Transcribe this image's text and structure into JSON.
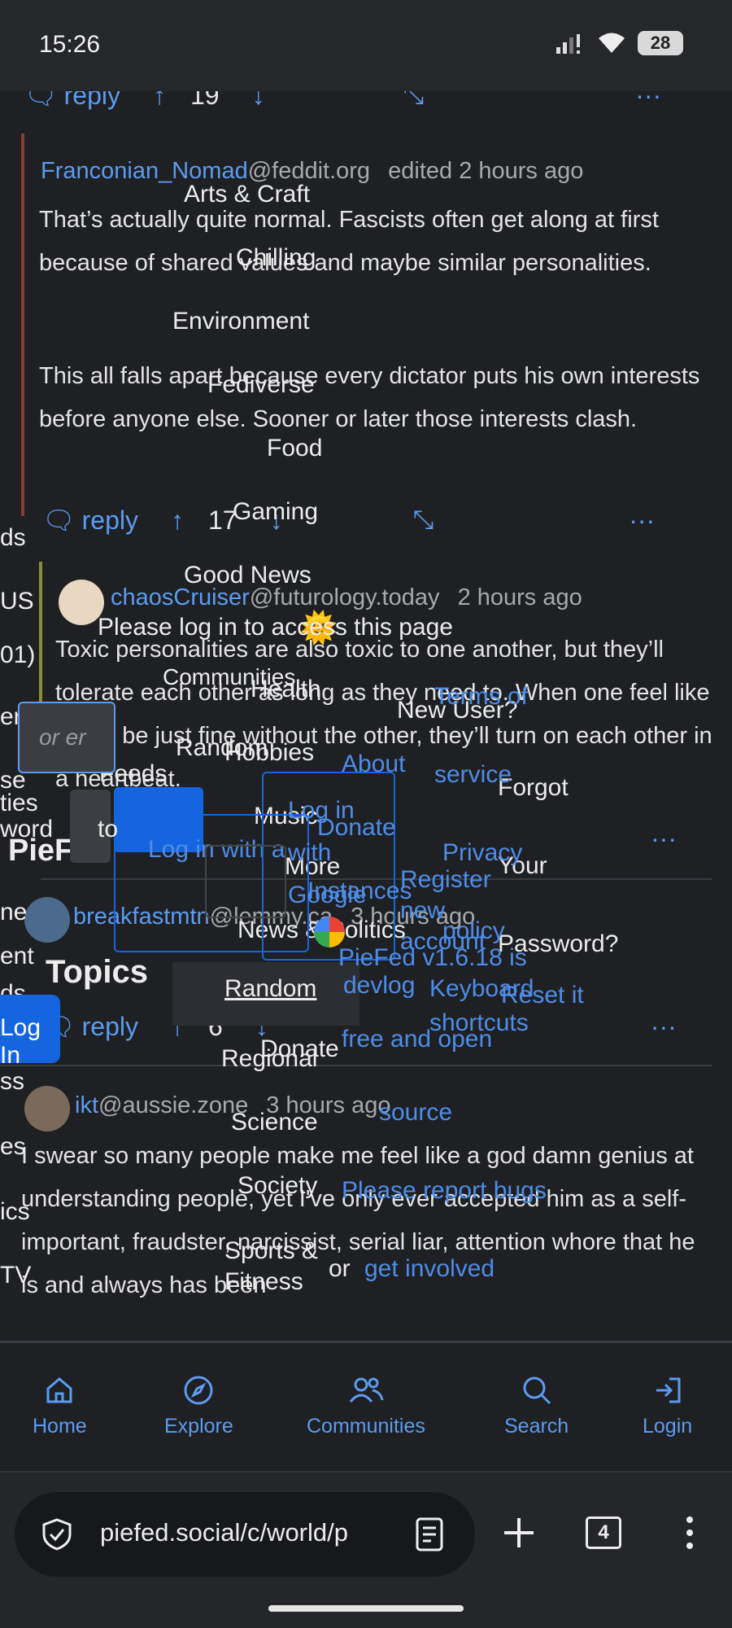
{
  "status_bar": {
    "time": "15:26",
    "battery": "28"
  },
  "thread": {
    "top_actions": {
      "reply": "reply",
      "score": "19"
    },
    "comment1": {
      "author": "Franconian_Nomad",
      "instance": "@feddit.org",
      "meta": "edited 2 hours ago",
      "para1": "That’s actually quite normal. Fascists often get along at first because of shared values and maybe similar personalities.",
      "para2": "This all falls apart because every dictator puts his own interests before anyone else. Sooner or later those interests clash.",
      "reply": "reply",
      "score": "17"
    },
    "comment2": {
      "author": "chaosCruiser",
      "instance": "@futurology.today",
      "meta": "2 hours ago",
      "text": "Toxic personalities are also toxic to one another, but they’ll tolerate each other as long as they need to. When one feel like they’ll be just fine without the other, they’ll turn on each other in a heartbeat."
    },
    "comment3": {
      "author": "breakfastmtn",
      "instance": "@lemmy.ca",
      "meta": "3 hours ago",
      "reply": "reply",
      "score": "6"
    },
    "comment4": {
      "author": "ikt",
      "instance": "@aussie.zone",
      "meta": "3 hours ago",
      "text": "I swear so many people make me feel like a god damn genius at understanding people, yet I've only ever accepted him as a self-important, fraudster, narcissist, serial liar, attention whore that he is and always has been"
    }
  },
  "overlay_menu": {
    "topics": [
      "Arts & Craft",
      "Chilling",
      "Environment",
      "Fediverse",
      "Food",
      "Gaming",
      "Good News",
      "Health",
      "Hobbies",
      "Music",
      "News & Politics",
      "Regional",
      "Science",
      "Society",
      "Sports & Fitness"
    ],
    "communities_label": "Communities",
    "random_label": "Random",
    "more_label": "More",
    "donate_label": "Donate",
    "topics_heading": "Topics",
    "random_button": "Random",
    "login_prompt": "Please log in to access this page",
    "login_button": "Log In",
    "login_google": "Log in with Google",
    "login_with_a": "Log in with a",
    "new_user": "New User?",
    "register": "Register new account",
    "forgot_password": "Forgot Your Password?",
    "reset_it": "Reset it",
    "footer_about": "About",
    "footer_donate": "Donate",
    "footer_terms": "Terms of service",
    "footer_privacy": "Privacy policy",
    "footer_instances": "Instances",
    "footer_version": "PieFed v1.6.18 is",
    "footer_devlog": "devlog",
    "footer_keyboard": "Keyboard shortcuts",
    "footer_free": "free and open",
    "footer_source": "source",
    "footer_report": "Please report bugs",
    "footer_or": "or",
    "footer_involved": "get involved",
    "left_fragments": [
      "ds",
      "US",
      "01)",
      "en",
      "se",
      "ties",
      "word",
      "ne",
      "ent",
      "ds",
      "ss",
      "es",
      "ics",
      "TV"
    ],
    "piefed_fragment": "PieF",
    "feeds": "Feeds",
    "to_label": "to",
    "input_placeholder": "or er"
  },
  "bottom_nav": {
    "items": [
      {
        "label": "Home",
        "icon": "home-icon"
      },
      {
        "label": "Explore",
        "icon": "compass-icon"
      },
      {
        "label": "Communities",
        "icon": "communities-icon"
      },
      {
        "label": "Search",
        "icon": "search-icon"
      },
      {
        "label": "Login",
        "icon": "login-icon"
      }
    ]
  },
  "browser": {
    "url": "piefed.social/c/world/p",
    "tab_count": "4"
  },
  "colors": {
    "accent": "#5b9cf0",
    "background": "#1f2024",
    "login_button": "#1565e0"
  }
}
